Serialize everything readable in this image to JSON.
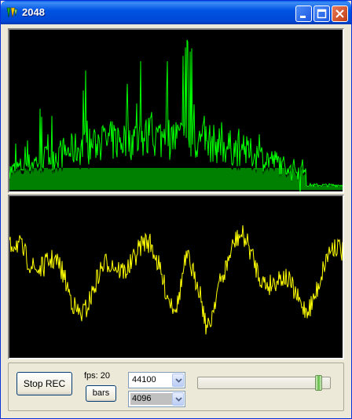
{
  "window": {
    "title": "2048",
    "controls": [
      "minimize",
      "maximize",
      "close"
    ]
  },
  "icons": {
    "app": "app-icon",
    "minimize": "minimize-icon",
    "maximize": "maximize-icon",
    "close": "close-icon"
  },
  "colors": {
    "spectrum": "#00ff00",
    "spectrum_fill": "#008000",
    "waveform": "#ffff00",
    "panel_bg": "#000000"
  },
  "controls": {
    "rec_button": "Stop REC",
    "fps_label": "fps: 20",
    "bars_button": "bars",
    "sample_rate": "44100",
    "buffer_size": "4096"
  },
  "slider": {
    "level": 0.95
  }
}
